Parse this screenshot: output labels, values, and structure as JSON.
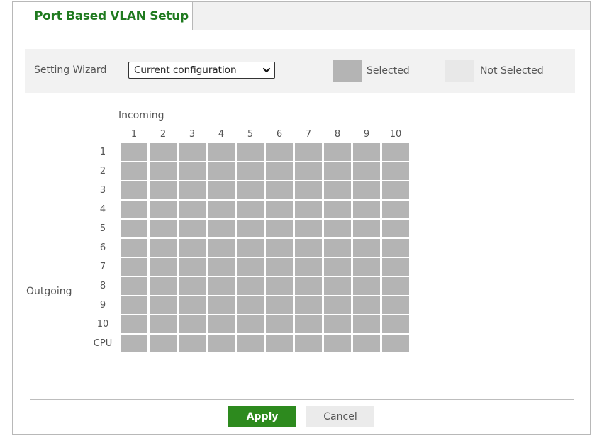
{
  "tab": {
    "title": "Port Based VLAN Setup"
  },
  "wizard": {
    "label": "Setting Wizard",
    "selected_value": "Current configuration"
  },
  "legend": {
    "selected_label": "Selected",
    "not_selected_label": "Not Selected",
    "selected_color": "#b4b4b4",
    "not_selected_color": "#e8e8e8"
  },
  "matrix": {
    "incoming_label": "Incoming",
    "outgoing_label": "Outgoing",
    "columns": [
      "1",
      "2",
      "3",
      "4",
      "5",
      "6",
      "7",
      "8",
      "9",
      "10"
    ],
    "rows": [
      "1",
      "2",
      "3",
      "4",
      "5",
      "6",
      "7",
      "8",
      "9",
      "10",
      "CPU"
    ]
  },
  "buttons": {
    "apply": "Apply",
    "cancel": "Cancel"
  },
  "colors": {
    "brand_green": "#1f7a1f",
    "apply_green": "#2d8a1e"
  }
}
